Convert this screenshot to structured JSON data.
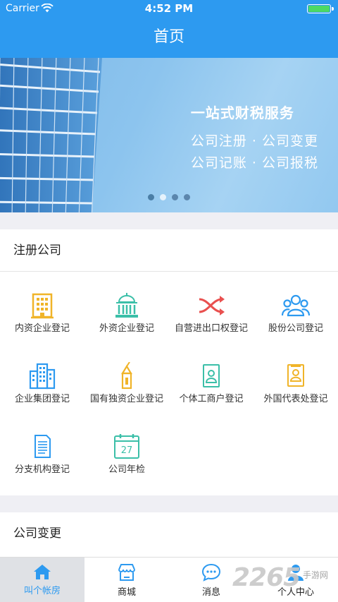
{
  "status_bar": {
    "carrier": "Carrier",
    "time": "4:52 PM"
  },
  "navbar": {
    "title": "首页"
  },
  "banner": {
    "title": "一站式财税服务",
    "line1": "公司注册 · 公司变更",
    "line2": "公司记账 · 公司报税",
    "page_count": 4,
    "active_page": 1
  },
  "sections": [
    {
      "title": "注册公司",
      "items": [
        {
          "label": "内资企业登记",
          "icon": "office-building-icon"
        },
        {
          "label": "外资企业登记",
          "icon": "government-building-icon"
        },
        {
          "label": "自营进出口权登记",
          "icon": "shuffle-arrows-icon"
        },
        {
          "label": "股份公司登记",
          "icon": "people-group-icon"
        },
        {
          "label": "企业集团登记",
          "icon": "city-buildings-icon"
        },
        {
          "label": "国有独资企业登记",
          "icon": "flag-tower-icon"
        },
        {
          "label": "个体工商户登记",
          "icon": "id-document-icon"
        },
        {
          "label": "外国代表处登记",
          "icon": "profile-document-icon"
        },
        {
          "label": "分支机构登记",
          "icon": "text-document-icon"
        },
        {
          "label": "公司年检",
          "icon": "calendar-icon",
          "day": "27"
        }
      ]
    },
    {
      "title": "公司变更"
    }
  ],
  "tabbar": [
    {
      "label": "叫个帐房",
      "icon": "home-icon",
      "active": true
    },
    {
      "label": "商城",
      "icon": "shop-icon",
      "active": false
    },
    {
      "label": "消息",
      "icon": "chat-bubble-icon",
      "active": false
    },
    {
      "label": "个人中心",
      "icon": "person-icon",
      "active": false
    }
  ],
  "watermark": {
    "brand": "2265",
    "sub": "手游网"
  },
  "colors": {
    "primary": "#2d9af0",
    "icon_yellow": "#f0b429",
    "icon_teal": "#3bbfa8",
    "icon_red": "#e9504f",
    "icon_blue": "#2d9af0"
  }
}
